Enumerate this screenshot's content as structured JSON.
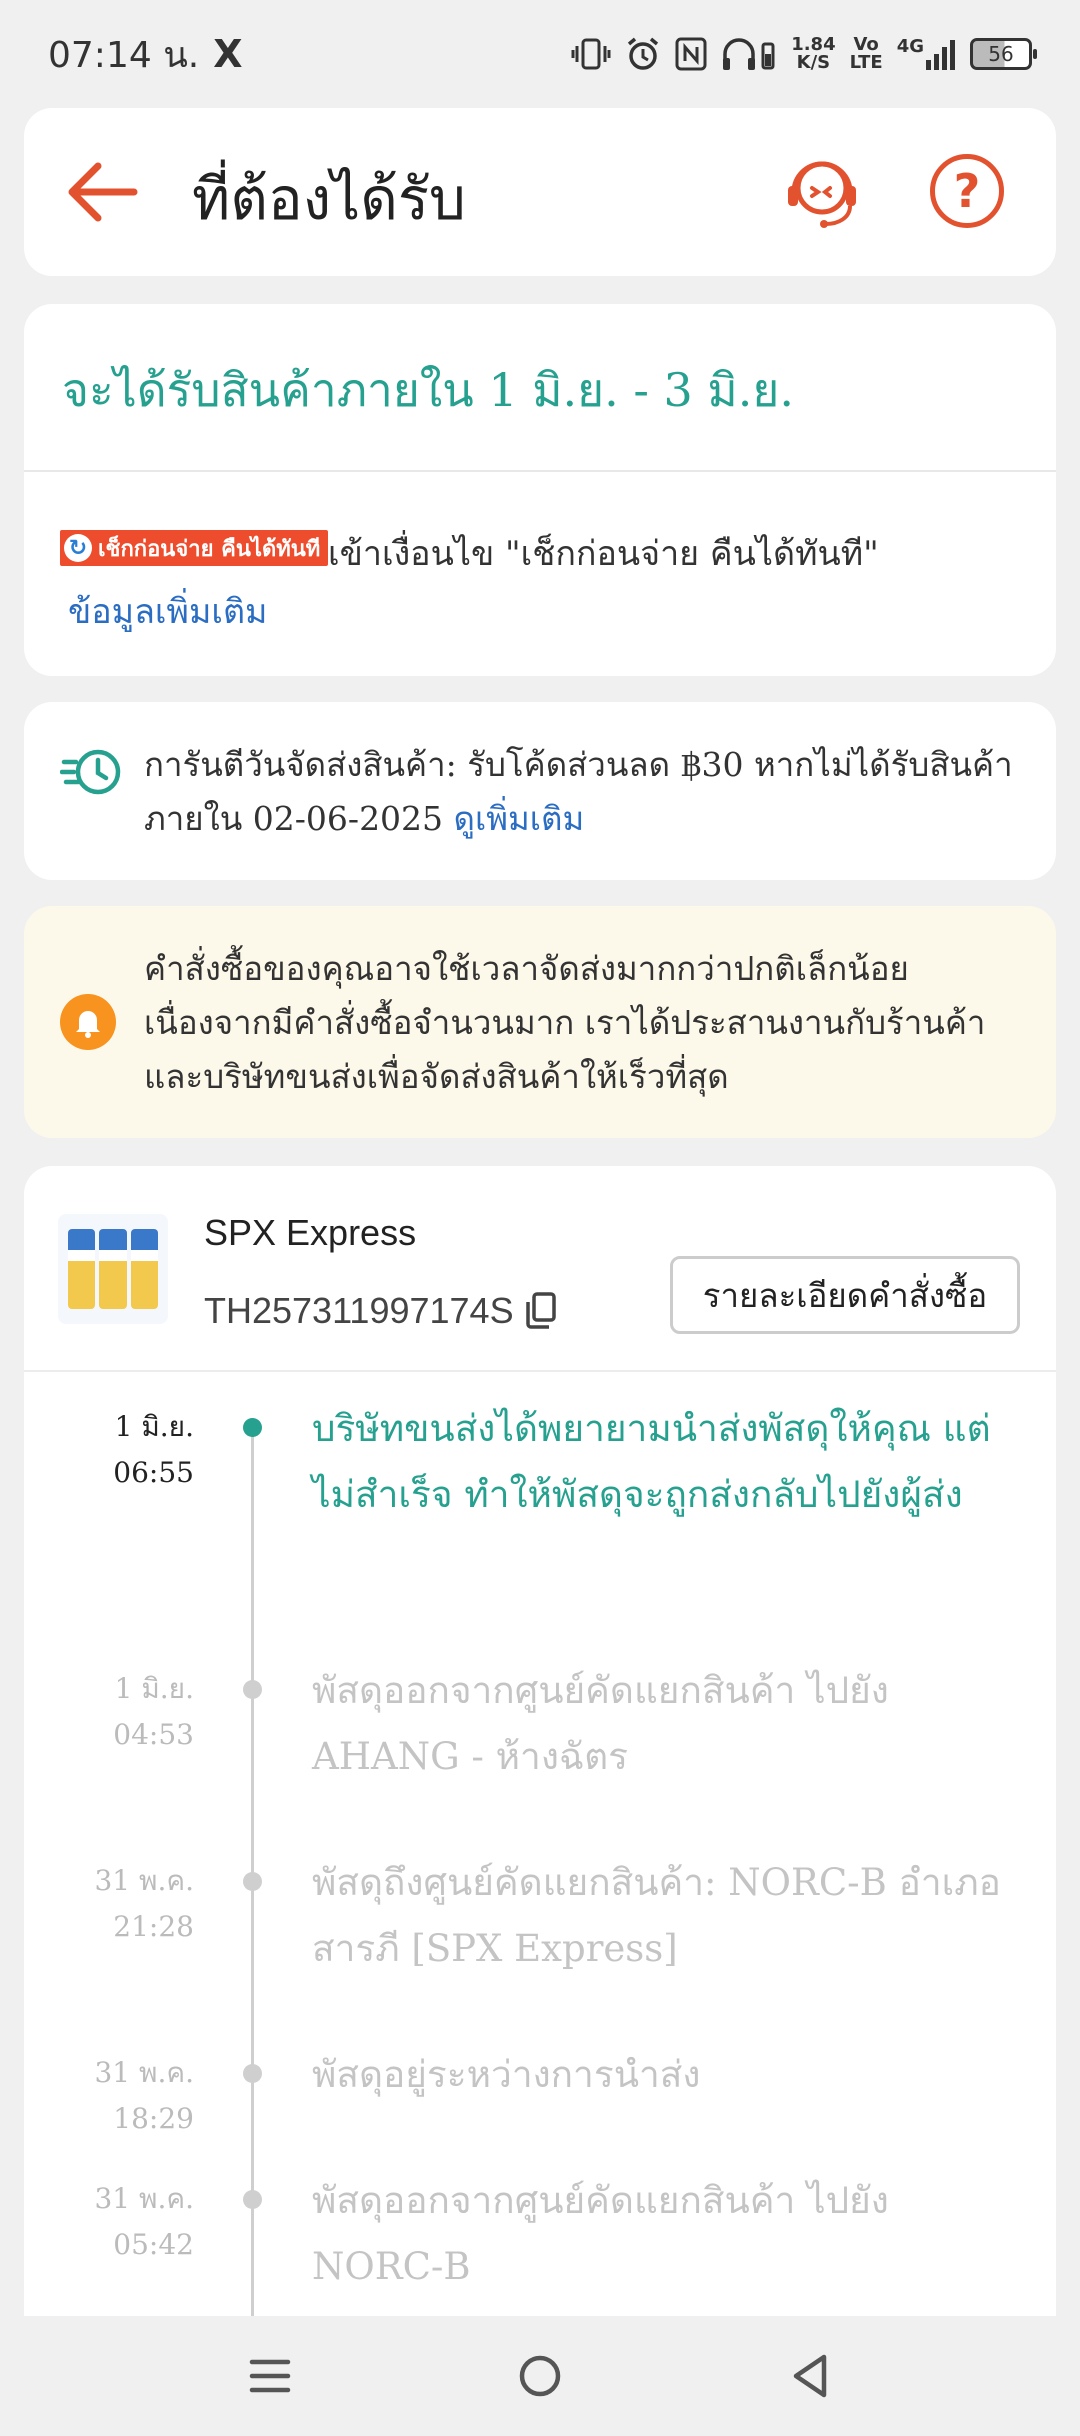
{
  "status_bar": {
    "time": "07:14 น.",
    "x_icon": "X",
    "network_speed_value": "1.84",
    "network_speed_unit": "K/S",
    "volte": "Vo",
    "volte_sub": "LTE",
    "network": "4G",
    "battery": "56",
    "icons": [
      "vibrate-icon",
      "alarm-icon",
      "nfc-icon",
      "headphones-icon",
      "signal-icon",
      "battery-icon"
    ]
  },
  "header": {
    "title": "ที่ต้องได้รับ",
    "back_icon": "arrow-left-icon",
    "support_icon": "customer-support-icon",
    "help_icon": "question-icon",
    "help_symbol": "?",
    "accent_color": "#e2522f"
  },
  "delivery": {
    "date_text": "จะได้รับสินค้าภายใน 1 มิ.ย. - 3 มิ.ย.",
    "badge_text": "เช็กก่อนจ่าย คืนได้ทันที",
    "badge_icon": "↻",
    "condition_text": "เข้าเงื่อนไข \"เช็กก่อนจ่าย คืนได้ทันที\"",
    "more_info": "ข้อมูลเพิ่มเติม"
  },
  "guarantee": {
    "text": "การันตีวันจัดส่งสินค้า: รับโค้ดส่วนลด ฿30 หากไม่ได้รับสินค้าภายใน 02-06-2025 ",
    "link": "ดูเพิ่มเติม"
  },
  "notice": {
    "text": "คำสั่งซื้อของคุณอาจใช้เวลาจัดส่งมากกว่าปกติเล็กน้อย เนื่องจากมีคำสั่งซื้อจำนวนมาก เราได้ประสานงานกับร้านค้าและบริษัทขนส่งเพื่อจัดส่งสินค้าให้เร็วที่สุด"
  },
  "tracking": {
    "carrier": "SPX Express",
    "tracking_number": "TH257311997174S",
    "order_detail_button": "รายละเอียดคำสั่งซื้อ",
    "events": [
      {
        "date": "1 มิ.ย.",
        "time": "06:55",
        "description": "บริษัทขนส่งได้พยายามนำส่งพัสดุให้คุณ แต่ไม่สำเร็จ ทำให้พัสดุจะถูกส่งกลับไปยังผู้ส่ง",
        "active": true
      },
      {
        "date": "1 มิ.ย.",
        "time": "04:53",
        "description": "พัสดุออกจากศูนย์คัดแยกสินค้า ไปยัง AHANG - ห้างฉัตร",
        "active": false
      },
      {
        "date": "31 พ.ค.",
        "time": "21:28",
        "description": "พัสดุถึงศูนย์คัดแยกสินค้า: NORC-B อำเภอสารภี [SPX Express]",
        "active": false
      },
      {
        "date": "31 พ.ค.",
        "time": "18:29",
        "description": "พัสดุอยู่ระหว่างการนำส่ง",
        "active": false
      },
      {
        "date": "31 พ.ค.",
        "time": "05:42",
        "description": "พัสดุออกจากศูนย์คัดแยกสินค้า ไปยัง NORC-B",
        "active": false
      }
    ]
  },
  "nav_bar": {
    "icons": [
      "menu-icon",
      "home-icon",
      "back-icon"
    ]
  }
}
